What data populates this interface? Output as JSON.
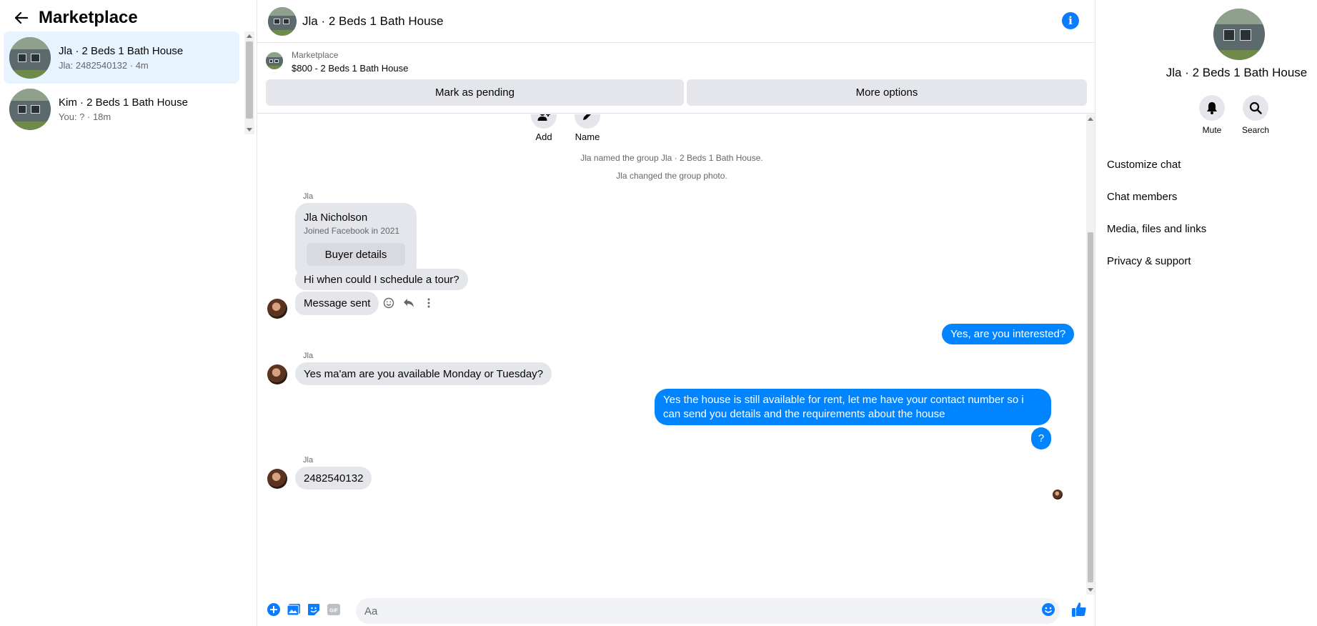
{
  "sidebar": {
    "title": "Marketplace",
    "conversations": [
      {
        "name": "Jla · 2 Beds 1 Bath House",
        "preview": "Jla: 2482540132 · 4m",
        "active": true
      },
      {
        "name": "Kim · 2 Beds 1 Bath House",
        "preview": "You: ? · 18m",
        "active": false
      }
    ]
  },
  "chat": {
    "title": "Jla · 2 Beds 1 Bath House",
    "marketplace": {
      "label": "Marketplace",
      "listing": "$800 - 2 Beds 1 Bath House",
      "mark_pending": "Mark as pending",
      "more_options": "More options"
    },
    "actions": {
      "add": "Add",
      "name": "Name"
    },
    "system_messages": [
      "Jla named the group Jla · 2 Beds 1 Bath House.",
      "Jla changed the group photo."
    ],
    "card": {
      "sender": "Jla",
      "name": "Jla Nicholson",
      "joined": "Joined Facebook in 2021",
      "button": "Buyer details"
    },
    "messages": {
      "m1": "Hi when could I schedule a tour?",
      "m2": "Message sent",
      "m3": "Yes, are you interested?",
      "m4_sender": "Jla",
      "m4": "Yes ma'am are you available Monday or Tuesday?",
      "m5": "Yes the house is still available for rent, let me have your contact number so i can send you details and the requirements about the house",
      "m6": "?",
      "m7_sender": "Jla",
      "m7": "2482540132"
    },
    "composer": {
      "placeholder": "Aa"
    }
  },
  "right_panel": {
    "title": "Jla · 2 Beds 1 Bath House",
    "mute": "Mute",
    "search": "Search",
    "menu": [
      "Customize chat",
      "Chat members",
      "Media, files and links",
      "Privacy & support"
    ]
  },
  "colors": {
    "accent": "#0084ff",
    "bubble_in": "#e4e6eb",
    "active_row": "#e7f3ff"
  }
}
